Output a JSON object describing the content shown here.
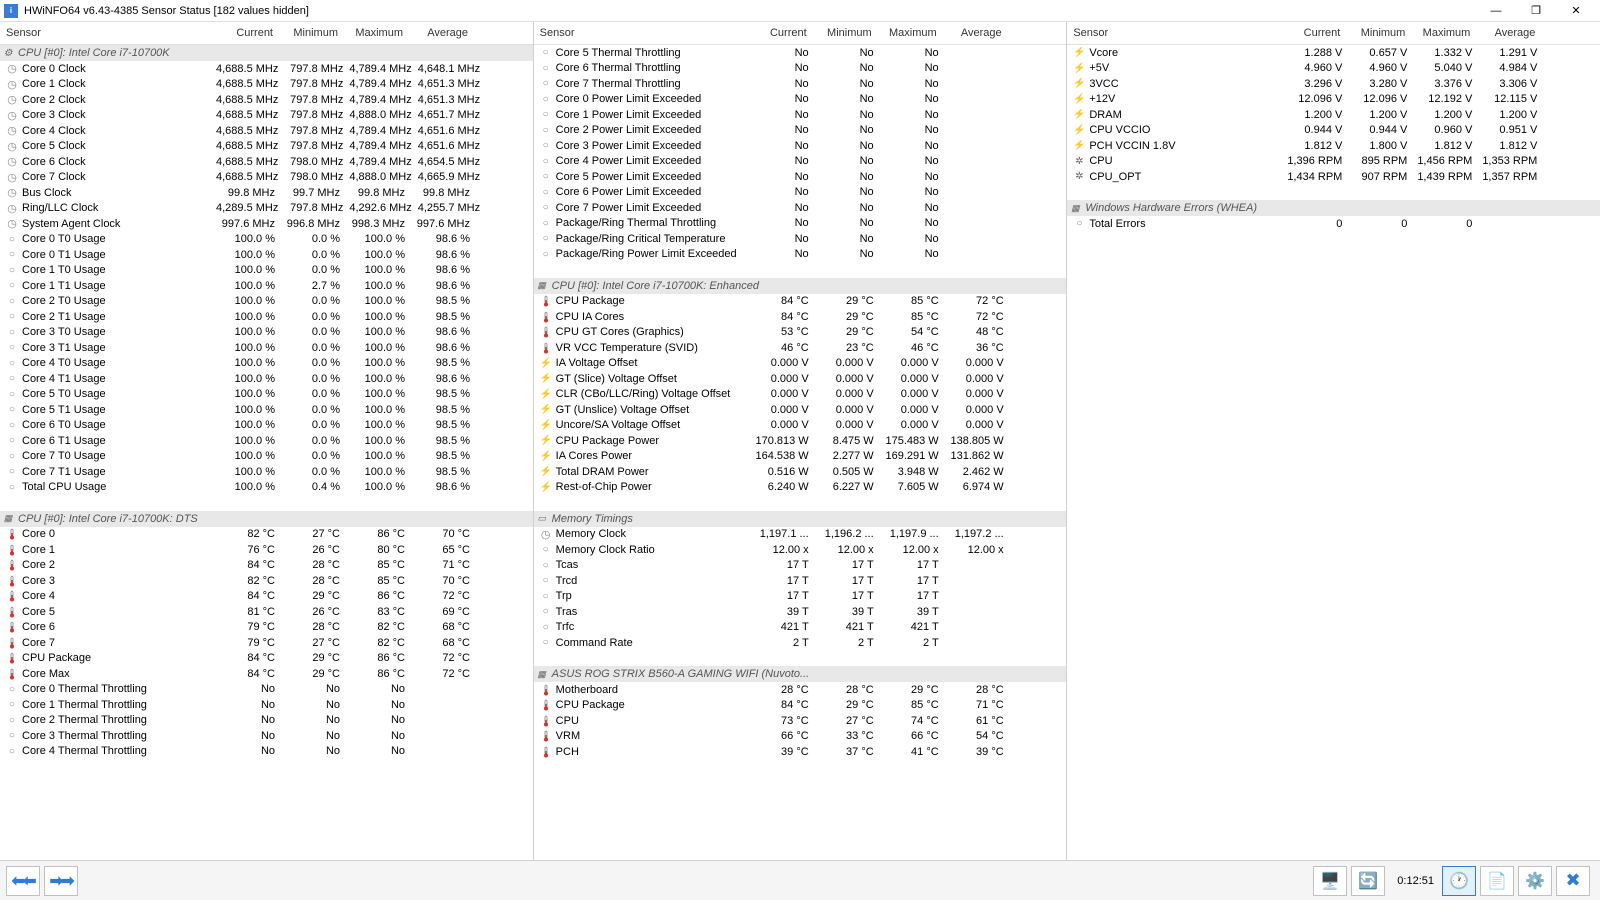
{
  "title": "HWiNFO64 v6.43-4385 Sensor Status [182 values hidden]",
  "columns": [
    "Sensor",
    "Current",
    "Minimum",
    "Maximum",
    "Average"
  ],
  "elapsed": "0:12:51",
  "panel1": [
    {
      "t": "g",
      "ic": "gear",
      "n": "CPU [#0]: Intel Core i7-10700K"
    },
    {
      "t": "d",
      "ic": "clock",
      "n": "Core 0 Clock",
      "v": [
        "4,688.5 MHz",
        "797.8 MHz",
        "4,789.4 MHz",
        "4,648.1 MHz"
      ]
    },
    {
      "t": "d",
      "ic": "clock",
      "n": "Core 1 Clock",
      "v": [
        "4,688.5 MHz",
        "797.8 MHz",
        "4,789.4 MHz",
        "4,651.3 MHz"
      ]
    },
    {
      "t": "d",
      "ic": "clock",
      "n": "Core 2 Clock",
      "v": [
        "4,688.5 MHz",
        "797.8 MHz",
        "4,789.4 MHz",
        "4,651.3 MHz"
      ]
    },
    {
      "t": "d",
      "ic": "clock",
      "n": "Core 3 Clock",
      "v": [
        "4,688.5 MHz",
        "797.8 MHz",
        "4,888.0 MHz",
        "4,651.7 MHz"
      ]
    },
    {
      "t": "d",
      "ic": "clock",
      "n": "Core 4 Clock",
      "v": [
        "4,688.5 MHz",
        "797.8 MHz",
        "4,789.4 MHz",
        "4,651.6 MHz"
      ]
    },
    {
      "t": "d",
      "ic": "clock",
      "n": "Core 5 Clock",
      "v": [
        "4,688.5 MHz",
        "797.8 MHz",
        "4,789.4 MHz",
        "4,651.6 MHz"
      ]
    },
    {
      "t": "d",
      "ic": "clock",
      "n": "Core 6 Clock",
      "v": [
        "4,688.5 MHz",
        "798.0 MHz",
        "4,789.4 MHz",
        "4,654.5 MHz"
      ]
    },
    {
      "t": "d",
      "ic": "clock",
      "n": "Core 7 Clock",
      "v": [
        "4,688.5 MHz",
        "798.0 MHz",
        "4,888.0 MHz",
        "4,665.9 MHz"
      ]
    },
    {
      "t": "d",
      "ic": "clock",
      "n": "Bus Clock",
      "v": [
        "99.8 MHz",
        "99.7 MHz",
        "99.8 MHz",
        "99.8 MHz"
      ]
    },
    {
      "t": "d",
      "ic": "clock",
      "n": "Ring/LLC Clock",
      "v": [
        "4,289.5 MHz",
        "797.8 MHz",
        "4,292.6 MHz",
        "4,255.7 MHz"
      ]
    },
    {
      "t": "d",
      "ic": "clock",
      "n": "System Agent Clock",
      "v": [
        "997.6 MHz",
        "996.8 MHz",
        "998.3 MHz",
        "997.6 MHz"
      ]
    },
    {
      "t": "d",
      "ic": "circle",
      "n": "Core 0 T0 Usage",
      "v": [
        "100.0 %",
        "0.0 %",
        "100.0 %",
        "98.6 %"
      ]
    },
    {
      "t": "d",
      "ic": "circle",
      "n": "Core 0 T1 Usage",
      "v": [
        "100.0 %",
        "0.0 %",
        "100.0 %",
        "98.6 %"
      ]
    },
    {
      "t": "d",
      "ic": "circle",
      "n": "Core 1 T0 Usage",
      "v": [
        "100.0 %",
        "0.0 %",
        "100.0 %",
        "98.6 %"
      ]
    },
    {
      "t": "d",
      "ic": "circle",
      "n": "Core 1 T1 Usage",
      "v": [
        "100.0 %",
        "2.7 %",
        "100.0 %",
        "98.6 %"
      ]
    },
    {
      "t": "d",
      "ic": "circle",
      "n": "Core 2 T0 Usage",
      "v": [
        "100.0 %",
        "0.0 %",
        "100.0 %",
        "98.5 %"
      ]
    },
    {
      "t": "d",
      "ic": "circle",
      "n": "Core 2 T1 Usage",
      "v": [
        "100.0 %",
        "0.0 %",
        "100.0 %",
        "98.5 %"
      ]
    },
    {
      "t": "d",
      "ic": "circle",
      "n": "Core 3 T0 Usage",
      "v": [
        "100.0 %",
        "0.0 %",
        "100.0 %",
        "98.6 %"
      ]
    },
    {
      "t": "d",
      "ic": "circle",
      "n": "Core 3 T1 Usage",
      "v": [
        "100.0 %",
        "0.0 %",
        "100.0 %",
        "98.6 %"
      ]
    },
    {
      "t": "d",
      "ic": "circle",
      "n": "Core 4 T0 Usage",
      "v": [
        "100.0 %",
        "0.0 %",
        "100.0 %",
        "98.5 %"
      ]
    },
    {
      "t": "d",
      "ic": "circle",
      "n": "Core 4 T1 Usage",
      "v": [
        "100.0 %",
        "0.0 %",
        "100.0 %",
        "98.6 %"
      ]
    },
    {
      "t": "d",
      "ic": "circle",
      "n": "Core 5 T0 Usage",
      "v": [
        "100.0 %",
        "0.0 %",
        "100.0 %",
        "98.5 %"
      ]
    },
    {
      "t": "d",
      "ic": "circle",
      "n": "Core 5 T1 Usage",
      "v": [
        "100.0 %",
        "0.0 %",
        "100.0 %",
        "98.5 %"
      ]
    },
    {
      "t": "d",
      "ic": "circle",
      "n": "Core 6 T0 Usage",
      "v": [
        "100.0 %",
        "0.0 %",
        "100.0 %",
        "98.5 %"
      ]
    },
    {
      "t": "d",
      "ic": "circle",
      "n": "Core 6 T1 Usage",
      "v": [
        "100.0 %",
        "0.0 %",
        "100.0 %",
        "98.5 %"
      ]
    },
    {
      "t": "d",
      "ic": "circle",
      "n": "Core 7 T0 Usage",
      "v": [
        "100.0 %",
        "0.0 %",
        "100.0 %",
        "98.5 %"
      ]
    },
    {
      "t": "d",
      "ic": "circle",
      "n": "Core 7 T1 Usage",
      "v": [
        "100.0 %",
        "0.0 %",
        "100.0 %",
        "98.5 %"
      ]
    },
    {
      "t": "d",
      "ic": "circle",
      "n": "Total CPU Usage",
      "v": [
        "100.0 %",
        "0.4 %",
        "100.0 %",
        "98.6 %"
      ]
    },
    {
      "t": "s"
    },
    {
      "t": "g",
      "ic": "chip",
      "n": "CPU [#0]: Intel Core i7-10700K: DTS"
    },
    {
      "t": "d",
      "ic": "temp",
      "n": "Core 0",
      "v": [
        "82 °C",
        "27 °C",
        "86 °C",
        "70 °C"
      ]
    },
    {
      "t": "d",
      "ic": "temp",
      "n": "Core 1",
      "v": [
        "76 °C",
        "26 °C",
        "80 °C",
        "65 °C"
      ]
    },
    {
      "t": "d",
      "ic": "temp",
      "n": "Core 2",
      "v": [
        "84 °C",
        "28 °C",
        "85 °C",
        "71 °C"
      ]
    },
    {
      "t": "d",
      "ic": "temp",
      "n": "Core 3",
      "v": [
        "82 °C",
        "28 °C",
        "85 °C",
        "70 °C"
      ]
    },
    {
      "t": "d",
      "ic": "temp",
      "n": "Core 4",
      "v": [
        "84 °C",
        "29 °C",
        "86 °C",
        "72 °C"
      ]
    },
    {
      "t": "d",
      "ic": "temp",
      "n": "Core 5",
      "v": [
        "81 °C",
        "26 °C",
        "83 °C",
        "69 °C"
      ]
    },
    {
      "t": "d",
      "ic": "temp",
      "n": "Core 6",
      "v": [
        "79 °C",
        "28 °C",
        "82 °C",
        "68 °C"
      ]
    },
    {
      "t": "d",
      "ic": "temp",
      "n": "Core 7",
      "v": [
        "79 °C",
        "27 °C",
        "82 °C",
        "68 °C"
      ]
    },
    {
      "t": "d",
      "ic": "temp",
      "n": "CPU Package",
      "v": [
        "84 °C",
        "29 °C",
        "86 °C",
        "72 °C"
      ]
    },
    {
      "t": "d",
      "ic": "temp",
      "n": "Core Max",
      "v": [
        "84 °C",
        "29 °C",
        "86 °C",
        "72 °C"
      ]
    },
    {
      "t": "d",
      "ic": "circle",
      "n": "Core 0 Thermal Throttling",
      "v": [
        "No",
        "No",
        "No",
        ""
      ]
    },
    {
      "t": "d",
      "ic": "circle",
      "n": "Core 1 Thermal Throttling",
      "v": [
        "No",
        "No",
        "No",
        ""
      ]
    },
    {
      "t": "d",
      "ic": "circle",
      "n": "Core 2 Thermal Throttling",
      "v": [
        "No",
        "No",
        "No",
        ""
      ]
    },
    {
      "t": "d",
      "ic": "circle",
      "n": "Core 3 Thermal Throttling",
      "v": [
        "No",
        "No",
        "No",
        ""
      ]
    },
    {
      "t": "d",
      "ic": "circle",
      "n": "Core 4 Thermal Throttling",
      "v": [
        "No",
        "No",
        "No",
        ""
      ]
    }
  ],
  "panel2": [
    {
      "t": "d",
      "ic": "circle",
      "n": "Core 5 Thermal Throttling",
      "v": [
        "No",
        "No",
        "No",
        ""
      ]
    },
    {
      "t": "d",
      "ic": "circle",
      "n": "Core 6 Thermal Throttling",
      "v": [
        "No",
        "No",
        "No",
        ""
      ]
    },
    {
      "t": "d",
      "ic": "circle",
      "n": "Core 7 Thermal Throttling",
      "v": [
        "No",
        "No",
        "No",
        ""
      ]
    },
    {
      "t": "d",
      "ic": "circle",
      "n": "Core 0 Power Limit Exceeded",
      "v": [
        "No",
        "No",
        "No",
        ""
      ]
    },
    {
      "t": "d",
      "ic": "circle",
      "n": "Core 1 Power Limit Exceeded",
      "v": [
        "No",
        "No",
        "No",
        ""
      ]
    },
    {
      "t": "d",
      "ic": "circle",
      "n": "Core 2 Power Limit Exceeded",
      "v": [
        "No",
        "No",
        "No",
        ""
      ]
    },
    {
      "t": "d",
      "ic": "circle",
      "n": "Core 3 Power Limit Exceeded",
      "v": [
        "No",
        "No",
        "No",
        ""
      ]
    },
    {
      "t": "d",
      "ic": "circle",
      "n": "Core 4 Power Limit Exceeded",
      "v": [
        "No",
        "No",
        "No",
        ""
      ]
    },
    {
      "t": "d",
      "ic": "circle",
      "n": "Core 5 Power Limit Exceeded",
      "v": [
        "No",
        "No",
        "No",
        ""
      ]
    },
    {
      "t": "d",
      "ic": "circle",
      "n": "Core 6 Power Limit Exceeded",
      "v": [
        "No",
        "No",
        "No",
        ""
      ]
    },
    {
      "t": "d",
      "ic": "circle",
      "n": "Core 7 Power Limit Exceeded",
      "v": [
        "No",
        "No",
        "No",
        ""
      ]
    },
    {
      "t": "d",
      "ic": "circle",
      "n": "Package/Ring Thermal Throttling",
      "v": [
        "No",
        "No",
        "No",
        ""
      ]
    },
    {
      "t": "d",
      "ic": "circle",
      "n": "Package/Ring Critical Temperature",
      "v": [
        "No",
        "No",
        "No",
        ""
      ]
    },
    {
      "t": "d",
      "ic": "circle",
      "n": "Package/Ring Power Limit Exceeded",
      "v": [
        "No",
        "No",
        "No",
        ""
      ]
    },
    {
      "t": "s"
    },
    {
      "t": "g",
      "ic": "chip",
      "n": "CPU [#0]: Intel Core i7-10700K: Enhanced"
    },
    {
      "t": "d",
      "ic": "temp",
      "n": "CPU Package",
      "v": [
        "84 °C",
        "29 °C",
        "85 °C",
        "72 °C"
      ]
    },
    {
      "t": "d",
      "ic": "temp",
      "n": "CPU IA Cores",
      "v": [
        "84 °C",
        "29 °C",
        "85 °C",
        "72 °C"
      ]
    },
    {
      "t": "d",
      "ic": "temp",
      "n": "CPU GT Cores (Graphics)",
      "v": [
        "53 °C",
        "29 °C",
        "54 °C",
        "48 °C"
      ]
    },
    {
      "t": "d",
      "ic": "temp",
      "n": "VR VCC Temperature (SVID)",
      "v": [
        "46 °C",
        "23 °C",
        "46 °C",
        "36 °C"
      ]
    },
    {
      "t": "d",
      "ic": "volt",
      "n": "IA Voltage Offset",
      "v": [
        "0.000 V",
        "0.000 V",
        "0.000 V",
        "0.000 V"
      ]
    },
    {
      "t": "d",
      "ic": "volt",
      "n": "GT (Slice) Voltage Offset",
      "v": [
        "0.000 V",
        "0.000 V",
        "0.000 V",
        "0.000 V"
      ]
    },
    {
      "t": "d",
      "ic": "volt",
      "n": "CLR (CBo/LLC/Ring) Voltage Offset",
      "v": [
        "0.000 V",
        "0.000 V",
        "0.000 V",
        "0.000 V"
      ]
    },
    {
      "t": "d",
      "ic": "volt",
      "n": "GT (Unslice) Voltage Offset",
      "v": [
        "0.000 V",
        "0.000 V",
        "0.000 V",
        "0.000 V"
      ]
    },
    {
      "t": "d",
      "ic": "volt",
      "n": "Uncore/SA Voltage Offset",
      "v": [
        "0.000 V",
        "0.000 V",
        "0.000 V",
        "0.000 V"
      ]
    },
    {
      "t": "d",
      "ic": "bolt",
      "n": "CPU Package Power",
      "v": [
        "170.813 W",
        "8.475 W",
        "175.483 W",
        "138.805 W"
      ]
    },
    {
      "t": "d",
      "ic": "bolt",
      "n": "IA Cores Power",
      "v": [
        "164.538 W",
        "2.277 W",
        "169.291 W",
        "131.862 W"
      ]
    },
    {
      "t": "d",
      "ic": "bolt",
      "n": "Total DRAM Power",
      "v": [
        "0.516 W",
        "0.505 W",
        "3.948 W",
        "2.462 W"
      ]
    },
    {
      "t": "d",
      "ic": "bolt",
      "n": "Rest-of-Chip Power",
      "v": [
        "6.240 W",
        "6.227 W",
        "7.605 W",
        "6.974 W"
      ]
    },
    {
      "t": "s"
    },
    {
      "t": "g",
      "ic": "mem",
      "n": "Memory Timings"
    },
    {
      "t": "d",
      "ic": "clock",
      "n": "Memory Clock",
      "v": [
        "1,197.1 ...",
        "1,196.2 ...",
        "1,197.9 ...",
        "1,197.2 ..."
      ]
    },
    {
      "t": "d",
      "ic": "circle",
      "n": "Memory Clock Ratio",
      "v": [
        "12.00 x",
        "12.00 x",
        "12.00 x",
        "12.00 x"
      ]
    },
    {
      "t": "d",
      "ic": "circle",
      "n": "Tcas",
      "v": [
        "17 T",
        "17 T",
        "17 T",
        ""
      ]
    },
    {
      "t": "d",
      "ic": "circle",
      "n": "Trcd",
      "v": [
        "17 T",
        "17 T",
        "17 T",
        ""
      ]
    },
    {
      "t": "d",
      "ic": "circle",
      "n": "Trp",
      "v": [
        "17 T",
        "17 T",
        "17 T",
        ""
      ]
    },
    {
      "t": "d",
      "ic": "circle",
      "n": "Tras",
      "v": [
        "39 T",
        "39 T",
        "39 T",
        ""
      ]
    },
    {
      "t": "d",
      "ic": "circle",
      "n": "Trfc",
      "v": [
        "421 T",
        "421 T",
        "421 T",
        ""
      ]
    },
    {
      "t": "d",
      "ic": "circle",
      "n": "Command Rate",
      "v": [
        "2 T",
        "2 T",
        "2 T",
        ""
      ]
    },
    {
      "t": "s"
    },
    {
      "t": "g",
      "ic": "chip",
      "n": "ASUS ROG STRIX B560-A GAMING WIFI (Nuvoto..."
    },
    {
      "t": "d",
      "ic": "temp",
      "n": "Motherboard",
      "v": [
        "28 °C",
        "28 °C",
        "29 °C",
        "28 °C"
      ]
    },
    {
      "t": "d",
      "ic": "temp",
      "n": "CPU Package",
      "v": [
        "84 °C",
        "29 °C",
        "85 °C",
        "71 °C"
      ]
    },
    {
      "t": "d",
      "ic": "temp",
      "n": "CPU",
      "v": [
        "73 °C",
        "27 °C",
        "74 °C",
        "61 °C"
      ]
    },
    {
      "t": "d",
      "ic": "temp",
      "n": "VRM",
      "v": [
        "66 °C",
        "33 °C",
        "66 °C",
        "54 °C"
      ]
    },
    {
      "t": "d",
      "ic": "temp",
      "n": "PCH",
      "v": [
        "39 °C",
        "37 °C",
        "41 °C",
        "39 °C"
      ]
    }
  ],
  "panel3": [
    {
      "t": "d",
      "ic": "volt",
      "n": "Vcore",
      "v": [
        "1.288 V",
        "0.657 V",
        "1.332 V",
        "1.291 V"
      ]
    },
    {
      "t": "d",
      "ic": "volt",
      "n": "+5V",
      "v": [
        "4.960 V",
        "4.960 V",
        "5.040 V",
        "4.984 V"
      ]
    },
    {
      "t": "d",
      "ic": "volt",
      "n": "3VCC",
      "v": [
        "3.296 V",
        "3.280 V",
        "3.376 V",
        "3.306 V"
      ]
    },
    {
      "t": "d",
      "ic": "volt",
      "n": "+12V",
      "v": [
        "12.096 V",
        "12.096 V",
        "12.192 V",
        "12.115 V"
      ]
    },
    {
      "t": "d",
      "ic": "volt",
      "n": "DRAM",
      "v": [
        "1.200 V",
        "1.200 V",
        "1.200 V",
        "1.200 V"
      ]
    },
    {
      "t": "d",
      "ic": "volt",
      "n": "CPU VCCIO",
      "v": [
        "0.944 V",
        "0.944 V",
        "0.960 V",
        "0.951 V"
      ]
    },
    {
      "t": "d",
      "ic": "volt",
      "n": "PCH VCCIN 1.8V",
      "v": [
        "1.812 V",
        "1.800 V",
        "1.812 V",
        "1.812 V"
      ]
    },
    {
      "t": "d",
      "ic": "fan",
      "n": "CPU",
      "v": [
        "1,396 RPM",
        "895 RPM",
        "1,456 RPM",
        "1,353 RPM"
      ]
    },
    {
      "t": "d",
      "ic": "fan",
      "n": "CPU_OPT",
      "v": [
        "1,434 RPM",
        "907 RPM",
        "1,439 RPM",
        "1,357 RPM"
      ]
    },
    {
      "t": "s"
    },
    {
      "t": "g",
      "ic": "chip",
      "n": "Windows Hardware Errors (WHEA)"
    },
    {
      "t": "d",
      "ic": "circle",
      "n": "Total Errors",
      "v": [
        "0",
        "0",
        "0",
        ""
      ]
    }
  ]
}
